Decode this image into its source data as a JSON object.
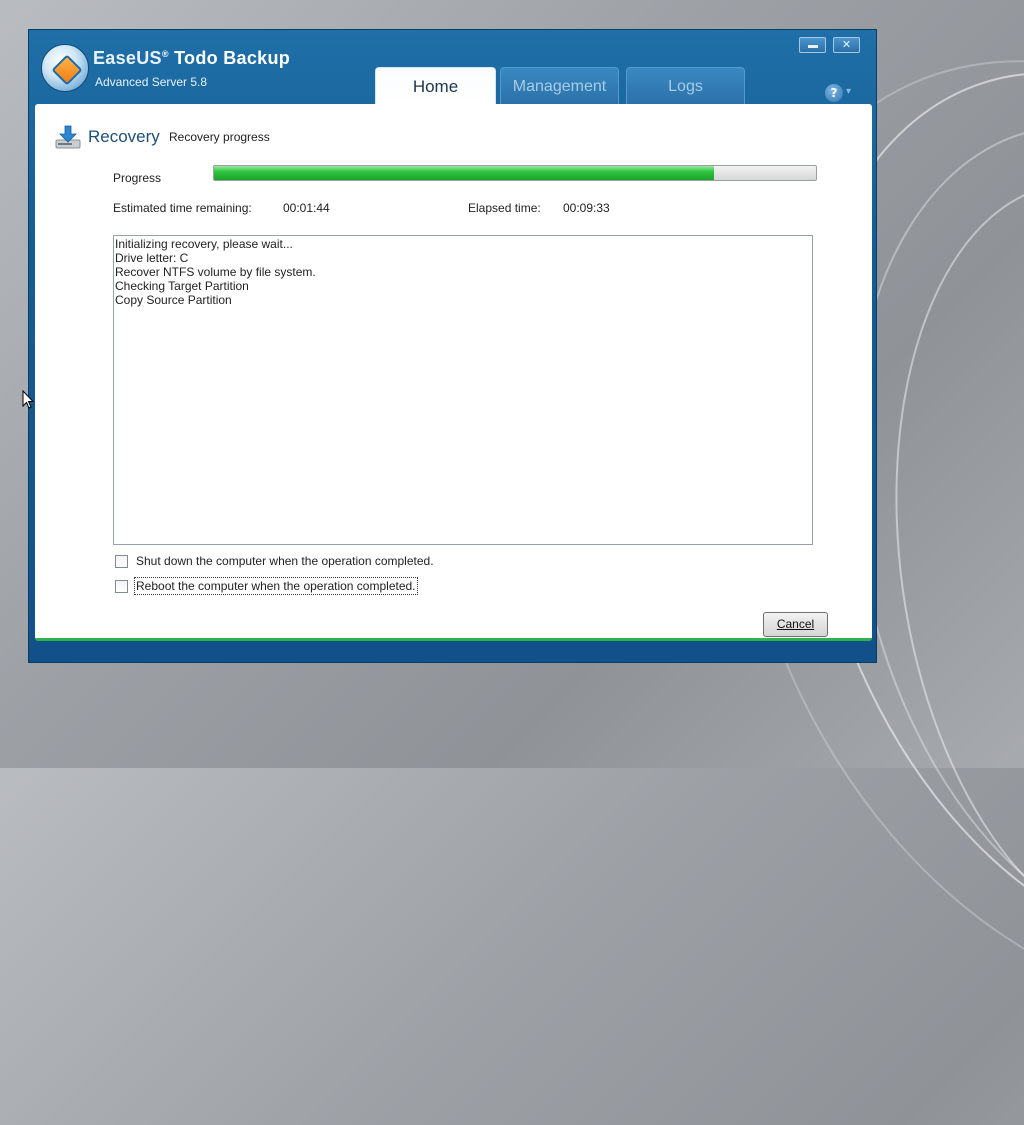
{
  "app": {
    "brand_prefix": "EaseUS",
    "brand_registered": "®",
    "brand_suffix": " Todo Backup",
    "edition": "Advanced Server 5.8"
  },
  "tabs": [
    {
      "label": "Home",
      "active": true
    },
    {
      "label": "Management",
      "active": false
    },
    {
      "label": "Logs",
      "active": false
    }
  ],
  "window_controls": {
    "minimize_icon": "minimize-icon",
    "close_glyph": "✕",
    "help_glyph": "?"
  },
  "page": {
    "title": "Recovery",
    "subtitle": "Recovery progress"
  },
  "progress": {
    "label": "Progress",
    "percent": 83,
    "estimated_label": "Estimated time remaining:",
    "estimated_value": "00:01:44",
    "elapsed_label": "Elapsed time:",
    "elapsed_value": "00:09:33"
  },
  "log": {
    "lines": [
      "Initializing recovery, please wait...",
      "Drive letter: C",
      "Recover NTFS volume by file system.",
      "Checking Target Partition",
      "Copy Source Partition"
    ]
  },
  "options": {
    "shutdown_label": "Shut down the computer when the operation completed.",
    "shutdown_checked": false,
    "reboot_label": "Reboot the computer when the operation completed.",
    "reboot_checked": false
  },
  "buttons": {
    "cancel_label": "Cancel"
  },
  "colors": {
    "window_blue": "#165c92",
    "progress_green": "#2ec43e",
    "accent_line": "#2fb34a"
  }
}
